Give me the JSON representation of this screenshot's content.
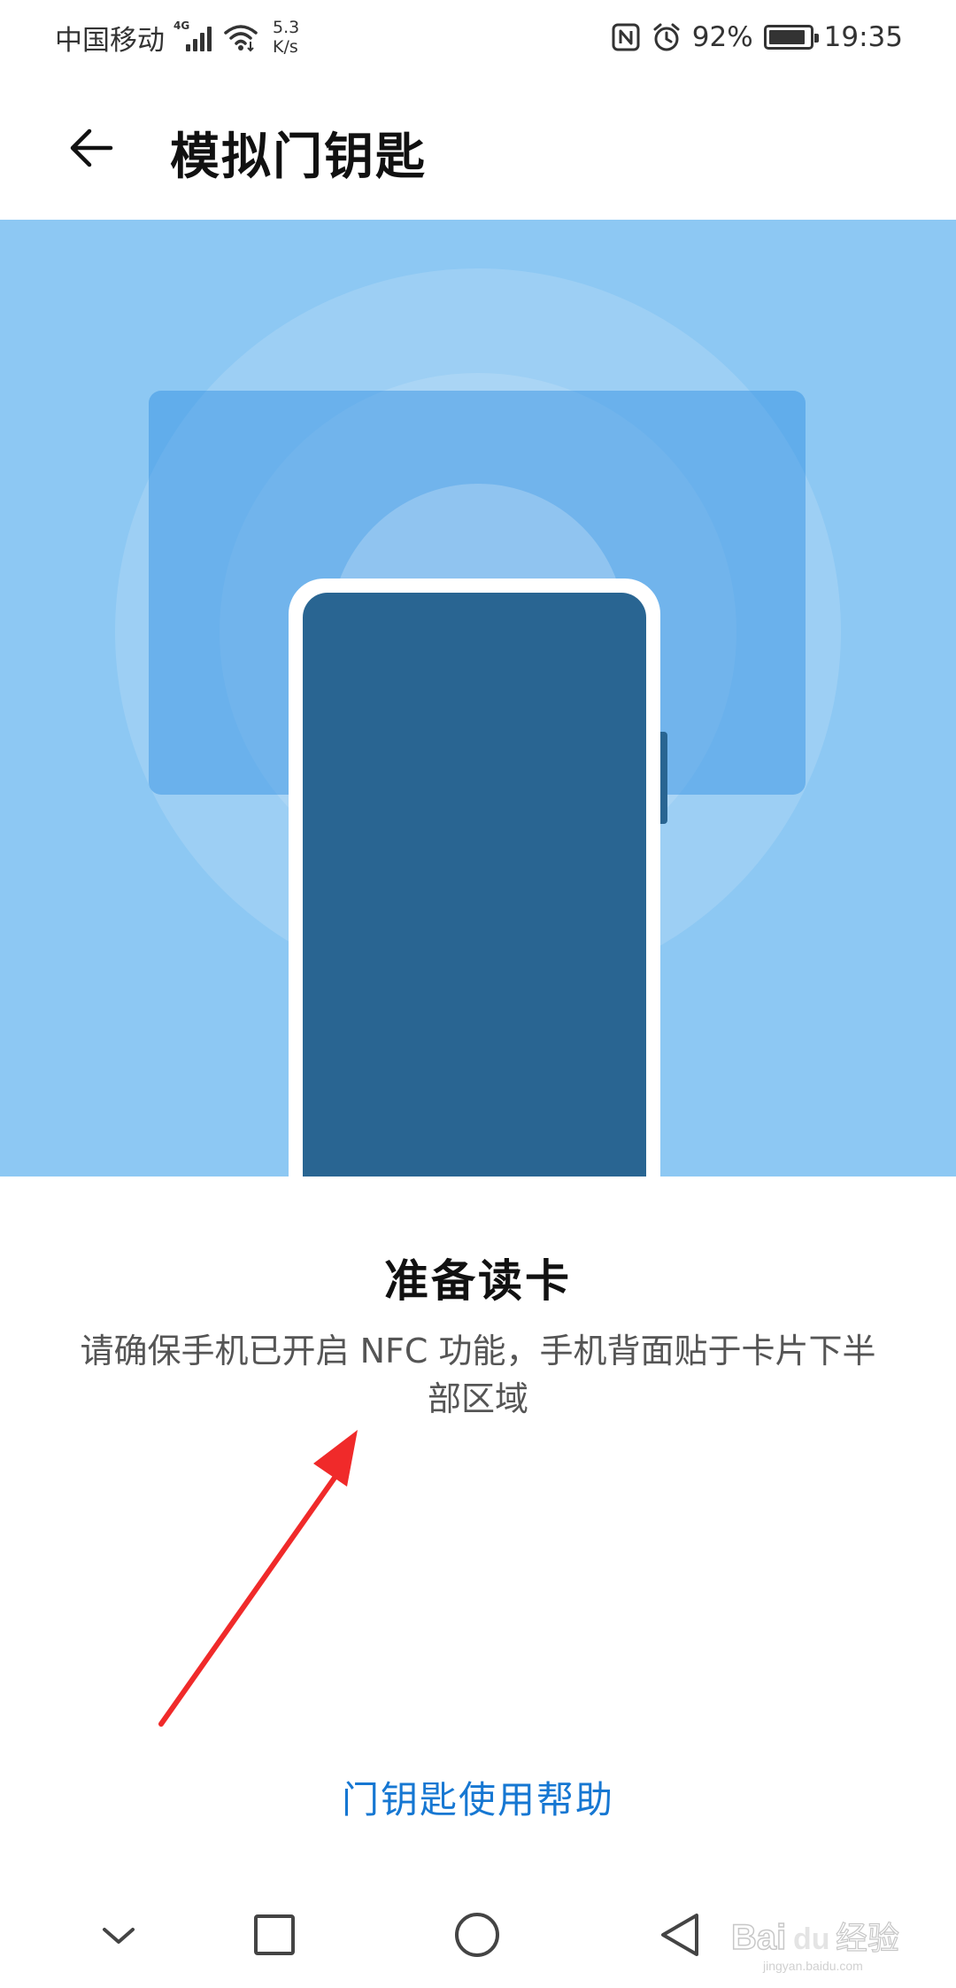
{
  "status_bar": {
    "carrier": "中国移动",
    "network_type": "4G",
    "net_speed_value": "5.3",
    "net_speed_unit": "K/s",
    "battery_percent": "92%",
    "battery_level": 0.92,
    "time": "19:35",
    "icons": [
      "signal-icon",
      "wifi-icon",
      "nfc-icon",
      "alarm-icon",
      "battery-icon"
    ]
  },
  "header": {
    "back_icon": "arrow-left-icon",
    "title": "模拟门钥匙"
  },
  "illustration": {
    "background_color": "#8dc8f3",
    "card_color": "#5ea9e6",
    "phone_screen_color": "#296592"
  },
  "content": {
    "title": "准备读卡",
    "description": "请确保手机已开启 NFC 功能，手机背面贴于卡片下半部区域"
  },
  "help_link": {
    "label": "门钥匙使用帮助",
    "color": "#1677d2"
  },
  "nav_bar": {
    "buttons": [
      "chevron-down-icon",
      "square-icon",
      "circle-icon",
      "triangle-back-icon"
    ]
  },
  "watermark": {
    "text": "Bai du 经验",
    "subtext": "jingyan.baidu.com"
  },
  "annotation": {
    "color": "#f02a2a"
  }
}
